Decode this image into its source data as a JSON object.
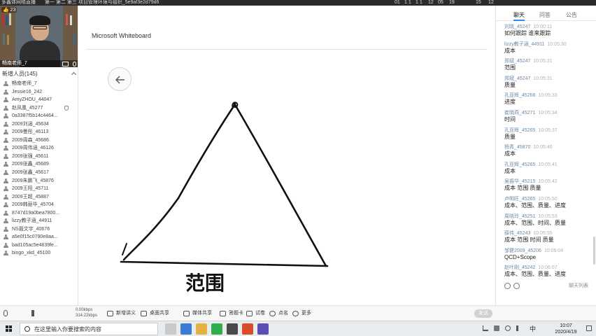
{
  "window": {
    "app_name": "多鑫体网络直播",
    "course_title": "第一 第二 第三 项目管理环境与组织_5e9af3e2d79d6",
    "metrics": [
      "01",
      "1 1",
      "1 1",
      "12",
      "05",
      "19",
      "15",
      "12"
    ]
  },
  "teacher_video": {
    "likes": "23",
    "caption": "畅南老师_7"
  },
  "members": {
    "count_label": "新增人员(145)",
    "list": [
      "畅南老师_7",
      "Jessie16_242",
      "AmyZHOU_44047",
      "赵凤凰_45277",
      "0a3387f5b14c4464...",
      "2009刘涵_45634",
      "2009曼彤_46113",
      "2009周森_45686",
      "2009周伟涵_46126",
      "2009张强_45611",
      "2009张鑫_45689",
      "2009张鑫_45617",
      "2009朱鹏飞_45876",
      "2009王阳_45711",
      "2009王超_45887",
      "2009韩丽华_45704",
      "8747d19a0bea7800...",
      "lizzy教子涵_44911",
      "NS聂文宇_40676",
      "a5e0f15c0790e8aa...",
      "bad105ac5e4839fe...",
      "bingo_xkd_45100"
    ]
  },
  "board": {
    "title": "Microsoft Whiteboard",
    "back_label": "←"
  },
  "chat": {
    "tabs": [
      "聊天",
      "问答",
      "公告"
    ],
    "messages": [
      {
        "name": "刘晓_45247",
        "time": "10:00:11",
        "text": "如何跟踪 谁来跟踪"
      },
      {
        "name": "lizzy教子涵_44911",
        "time": "10:05:30",
        "text": "成本"
      },
      {
        "name": "郑斌_45247",
        "time": "10:05:31",
        "text": "范围"
      },
      {
        "name": "郑斌_45247",
        "time": "10:05:31",
        "text": "质量"
      },
      {
        "name": "孔亚辉_45266",
        "time": "10:05:33",
        "text": "进度"
      },
      {
        "name": "崔晓燕_45271",
        "time": "10:05:34",
        "text": "时间"
      },
      {
        "name": "孔亚辉_45265",
        "time": "10:05:37",
        "text": "质量"
      },
      {
        "name": "杨青_45870",
        "time": "10:05:40",
        "text": "成本"
      },
      {
        "name": "孔亚辉_45265",
        "time": "10:05:41",
        "text": "成本"
      },
      {
        "name": "吴振华_45215",
        "time": "10:05:42",
        "text": "成本 范围 质量"
      },
      {
        "name": "卢明旺_45265",
        "time": "10:05:50",
        "text": "成本、范围、质量、进度"
      },
      {
        "name": "周晓玲_45251",
        "time": "10:05:53",
        "text": "成本、范围、时间、质量"
      },
      {
        "name": "薛伟_45243",
        "time": "10:05:55",
        "text": "成本 范围 时间 质量"
      },
      {
        "name": "邹健2009_45206",
        "time": "10:06:04",
        "text": "QCD+Scope"
      },
      {
        "name": "赵叶刚_45242",
        "time": "10:06:07",
        "text": "成本、范围、质量、进度"
      }
    ],
    "more_label": "聊天列表"
  },
  "toolbar": {
    "rate_up": "0.00kbps",
    "rate_down": "314.22kbps",
    "buttons": [
      "新增讲义",
      "桌面共享",
      "媒体共享",
      "答题卡",
      "试卷",
      "点名",
      "更多"
    ],
    "send_label": "发送"
  },
  "taskbar": {
    "search_placeholder": "在这里输入你要搜索的内容",
    "ime": "中",
    "time": "10:07",
    "date": "2020/4/19"
  },
  "drawing": {
    "handwritten_text": "范围"
  },
  "colors": {
    "accent": "#2a8cf0",
    "chat_name": "#6d88a8",
    "ink": "#111111"
  }
}
